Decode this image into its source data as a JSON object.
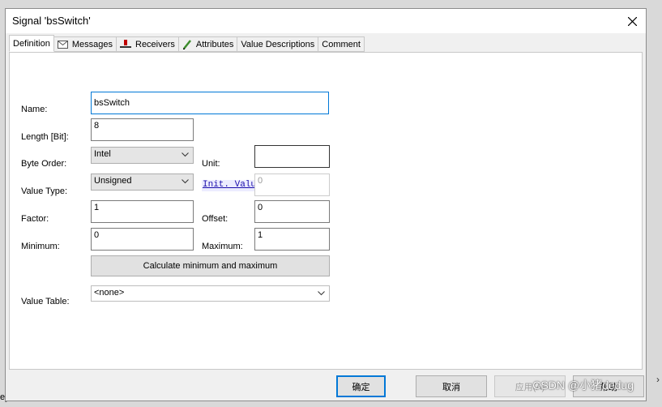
{
  "window": {
    "title": "Signal 'bsSwitch'"
  },
  "tabs": [
    {
      "label": "Definition",
      "icon": "none"
    },
    {
      "label": "Messages",
      "icon": "envelope-icon"
    },
    {
      "label": "Receivers",
      "icon": "receiver-icon"
    },
    {
      "label": "Attributes",
      "icon": "pencil-icon"
    },
    {
      "label": "Value Descriptions",
      "icon": "none"
    },
    {
      "label": "Comment",
      "icon": "none"
    }
  ],
  "form": {
    "name": {
      "label": "Name:",
      "value": "bsSwitch"
    },
    "length": {
      "label": "Length [Bit]:",
      "value": "8"
    },
    "byte_order": {
      "label": "Byte Order:",
      "value": "Intel"
    },
    "unit": {
      "label": "Unit:",
      "value": ""
    },
    "value_type": {
      "label": "Value Type:",
      "value": "Unsigned"
    },
    "init_value": {
      "label": "Init. Valu",
      "value": "0"
    },
    "factor": {
      "label": "Factor:",
      "value": "1"
    },
    "offset": {
      "label": "Offset:",
      "value": "0"
    },
    "minimum": {
      "label": "Minimum:",
      "value": "0"
    },
    "maximum": {
      "label": "Maximum:",
      "value": "1"
    },
    "calc_button": "Calculate minimum and maximum",
    "value_table": {
      "label": "Value Table:",
      "value": "<none>"
    }
  },
  "buttons": {
    "ok": "确定",
    "cancel": "取消",
    "apply": "应用(A)",
    "help": "帮助"
  },
  "watermark": "CSDN @小猪dedug",
  "edge_text": "e] ="
}
